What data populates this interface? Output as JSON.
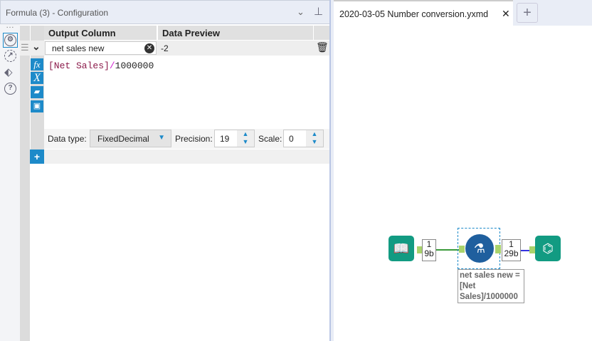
{
  "panel": {
    "title": "Formula (3) - Configuration"
  },
  "grid": {
    "col_output": "Output Column",
    "col_preview": "Data Preview",
    "row": {
      "output_column": "net sales new",
      "preview": "-2"
    },
    "expression": {
      "field": "[Net Sales]",
      "operator": "/",
      "number": "1000000"
    },
    "data_type_label": "Data type:",
    "data_type": "FixedDecimal",
    "precision_label": "Precision:",
    "precision": "19",
    "scale_label": "Scale:",
    "scale": "0"
  },
  "canvas": {
    "tab": "2020-03-05 Number conversion.yxmd",
    "input_count": {
      "records": "1",
      "size": "9b"
    },
    "output_count": {
      "records": "1",
      "size": "29b"
    },
    "annotation": [
      "net sales new =",
      "[Net",
      "Sales]/1000000"
    ]
  },
  "colors": {
    "accent": "#1d8ac9",
    "tool_green": "#129b82",
    "formula_blue": "#1f5f9e"
  }
}
